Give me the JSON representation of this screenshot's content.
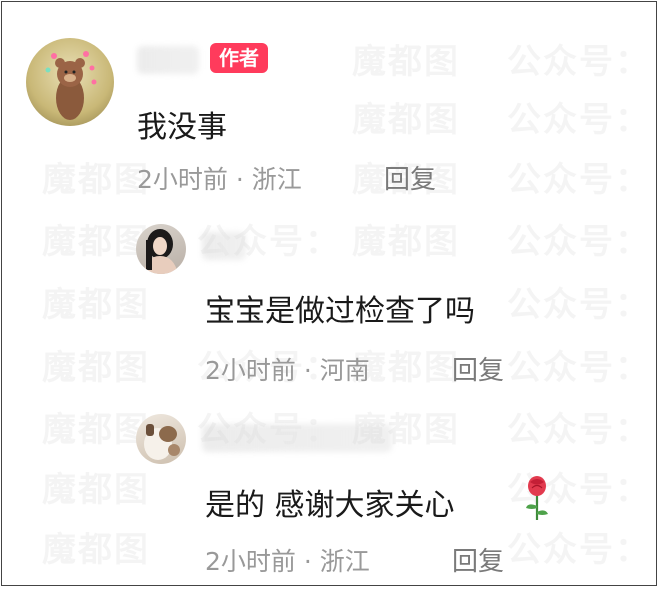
{
  "watermark": {
    "text_cn": "魔都图",
    "text_gzh": "公众号："
  },
  "main_comment": {
    "author_badge": "作者",
    "content": "我没事",
    "time": "2小时前",
    "separator": "·",
    "location": "浙江",
    "reply_label": "回复",
    "avatar_icon": "cartoon-bear-avatar-icon"
  },
  "replies": [
    {
      "content": "宝宝是做过检查了吗",
      "time": "2小时前",
      "separator": "·",
      "location": "河南",
      "reply_label": "回复",
      "avatar_icon": "girl-photo-avatar-icon"
    },
    {
      "content": "是的 感谢大家关心",
      "emoji": "🌹",
      "emoji_icon": "rose-icon",
      "time": "2小时前",
      "separator": "·",
      "location": "浙江",
      "reply_label": "回复",
      "avatar_icon": "photo-avatar-icon"
    }
  ],
  "colors": {
    "badge": "#ff3b5c",
    "text": "#1a1a1a",
    "meta": "#999999"
  }
}
